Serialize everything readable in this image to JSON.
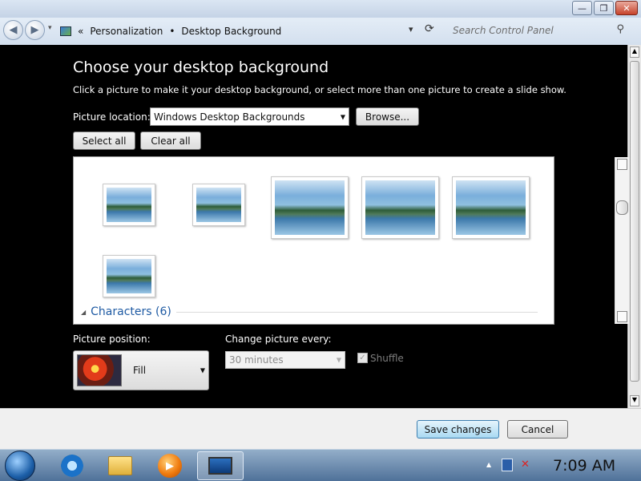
{
  "window": {
    "minimize": "—",
    "maximize": "❐",
    "close": "✕"
  },
  "address": {
    "back": "◀",
    "forward": "▶",
    "sep": "«",
    "crumbs": [
      "Personalization",
      "Desktop Background"
    ],
    "crumb_sep": "•",
    "dropdown": "▾",
    "refresh": "⟳",
    "search_placeholder": "Search Control Panel"
  },
  "page": {
    "title": "Choose your desktop background",
    "subtitle": "Click a picture to make it your desktop background, or select more than one picture to create a slide show.",
    "picture_location_label": "Picture location:",
    "picture_location_value": "Windows Desktop Backgrounds",
    "browse": "Browse...",
    "select_all": "Select all",
    "clear_all": "Clear all",
    "group_label": "Characters (6)",
    "group_toggle": "◢",
    "picture_position_label": "Picture position:",
    "picture_position_value": "Fill",
    "change_every_label": "Change picture every:",
    "change_every_value": "30 minutes",
    "shuffle_label": "Shuffle",
    "shuffle_checked": true
  },
  "footer": {
    "save": "Save changes",
    "cancel": "Cancel"
  },
  "taskbar": {
    "clock": "7:09 AM",
    "tray_arrow": "▲"
  }
}
